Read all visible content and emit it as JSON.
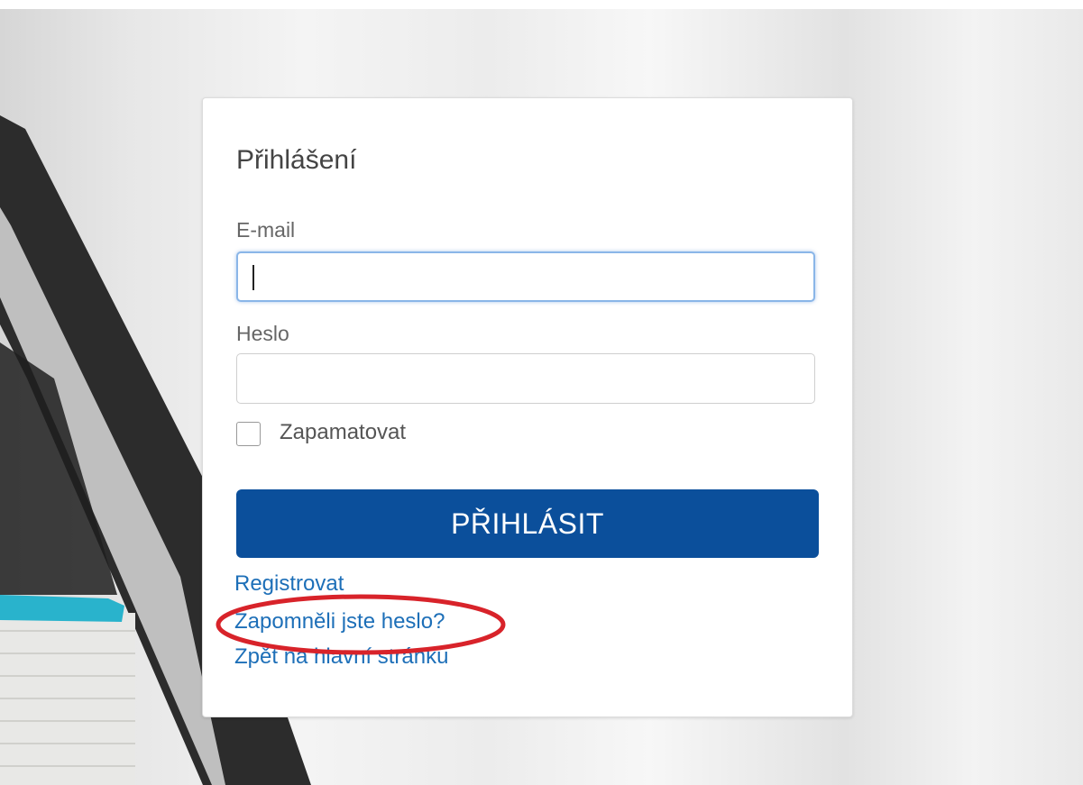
{
  "login": {
    "title": "Přihlášení",
    "email_label": "E-mail",
    "email_value": "",
    "password_label": "Heslo",
    "password_value": "",
    "remember_label": "Zapamatovat",
    "submit_label": "PŘIHLÁSIT",
    "links": {
      "register": "Registrovat",
      "forgot_password": "Zapomněli jste heslo?",
      "back_home": "Zpět na hlavní stránku"
    }
  },
  "colors": {
    "primary_button": "#0b4f9b",
    "link": "#1d6fb8",
    "highlight_ellipse": "#d8232a",
    "accent_strap": "#29b3cc"
  }
}
